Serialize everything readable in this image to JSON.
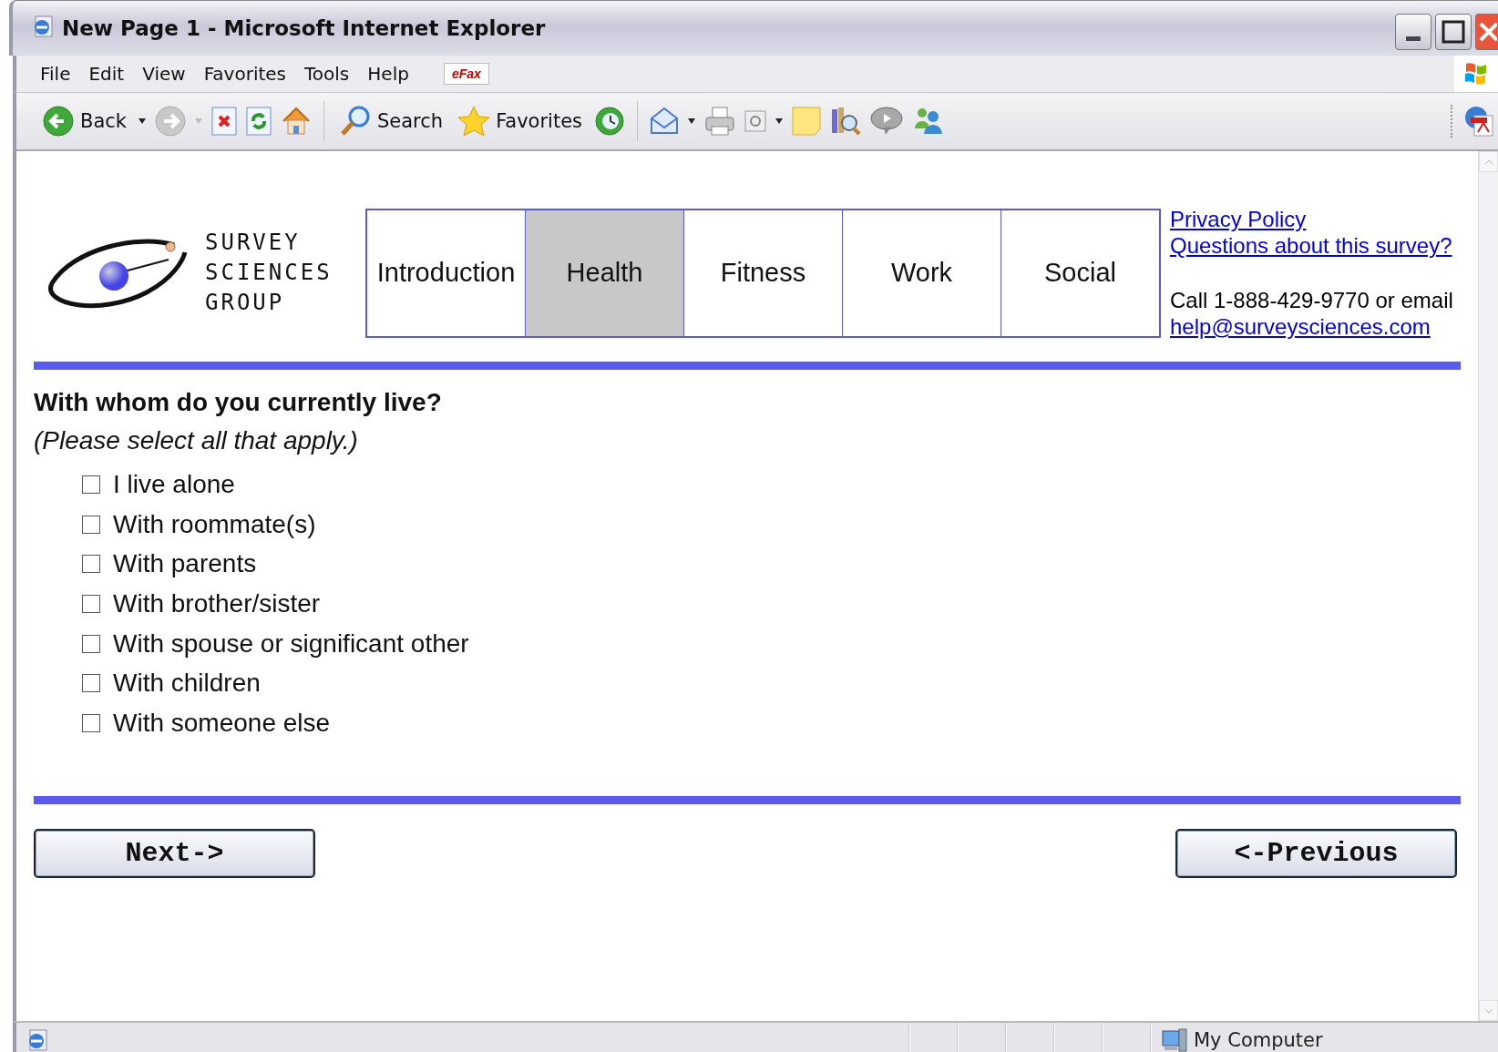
{
  "window": {
    "title": "New Page 1 - Microsoft Internet Explorer"
  },
  "menu": [
    "File",
    "Edit",
    "View",
    "Favorites",
    "Tools",
    "Help"
  ],
  "menu_badge": "eFax",
  "toolbar": {
    "back": "Back",
    "search": "Search",
    "favorites": "Favorites"
  },
  "logo": {
    "lines": [
      "SURVEY",
      "SCIENCES",
      "GROUP"
    ]
  },
  "tabs": [
    {
      "label": "Introduction",
      "selected": false
    },
    {
      "label": "Health",
      "selected": true
    },
    {
      "label": "Fitness",
      "selected": false
    },
    {
      "label": "Work",
      "selected": false
    },
    {
      "label": "Social",
      "selected": false
    }
  ],
  "links": [
    "Privacy Policy",
    "Questions about this survey?"
  ],
  "contact": {
    "text": "Call 1-888-429-9770 or email",
    "email": "help@surveysciences.com"
  },
  "question": "With whom do you currently live?",
  "hint": "(Please select all that apply.)",
  "options": [
    {
      "label": "I live alone",
      "checked": false
    },
    {
      "label": "With roommate(s)",
      "checked": false
    },
    {
      "label": "With parents",
      "checked": false
    },
    {
      "label": "With brother/sister",
      "checked": false
    },
    {
      "label": "With spouse or significant other",
      "checked": false
    },
    {
      "label": "With children",
      "checked": false
    },
    {
      "label": "With someone else",
      "checked": false
    }
  ],
  "buttons": {
    "next": "Next->",
    "previous": "<-Previous"
  },
  "status_bar": {
    "zone": "My Computer"
  }
}
